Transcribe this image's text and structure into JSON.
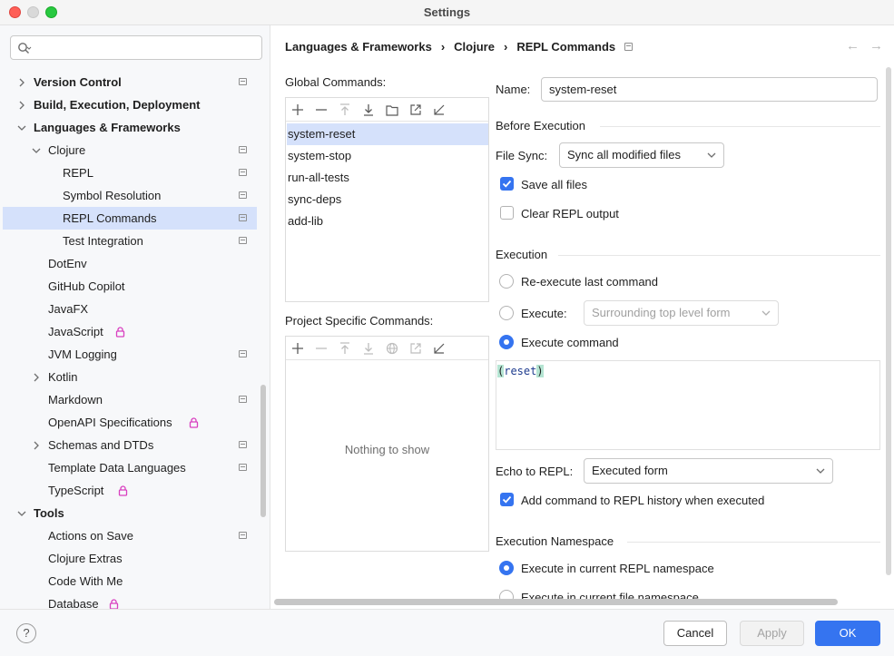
{
  "window": {
    "title": "Settings"
  },
  "search": {
    "placeholder": ""
  },
  "tree": {
    "items": [
      {
        "label": "Version Control"
      },
      {
        "label": "Build, Execution, Deployment"
      },
      {
        "label": "Languages & Frameworks"
      },
      {
        "label": "Clojure"
      },
      {
        "label": "REPL"
      },
      {
        "label": "Symbol Resolution"
      },
      {
        "label": "REPL Commands"
      },
      {
        "label": "Test Integration"
      },
      {
        "label": "DotEnv"
      },
      {
        "label": "GitHub Copilot"
      },
      {
        "label": "JavaFX"
      },
      {
        "label": "JavaScript"
      },
      {
        "label": "JVM Logging"
      },
      {
        "label": "Kotlin"
      },
      {
        "label": "Markdown"
      },
      {
        "label": "OpenAPI Specifications"
      },
      {
        "label": "Schemas and DTDs"
      },
      {
        "label": "Template Data Languages"
      },
      {
        "label": "TypeScript"
      },
      {
        "label": "Tools"
      },
      {
        "label": "Actions on Save"
      },
      {
        "label": "Clojure Extras"
      },
      {
        "label": "Code With Me"
      },
      {
        "label": "Database"
      }
    ]
  },
  "breadcrumb": {
    "part1": "Languages & Frameworks",
    "part2": "Clojure",
    "part3": "REPL Commands",
    "sep": "›"
  },
  "global_commands": {
    "label": "Global Commands:",
    "items": [
      "system-reset",
      "system-stop",
      "run-all-tests",
      "sync-deps",
      "add-lib"
    ]
  },
  "project_commands": {
    "label": "Project Specific Commands:",
    "empty_text": "Nothing to show"
  },
  "form": {
    "name_label": "Name:",
    "name_value": "system-reset",
    "before_execution": "Before Execution",
    "file_sync_label": "File Sync:",
    "file_sync_value": "Sync all modified files",
    "save_all_label": "Save all files",
    "save_all_checked": true,
    "clear_repl_label": "Clear REPL output",
    "clear_repl_checked": false,
    "execution": "Execution",
    "re_execute_label": "Re-execute last command",
    "execute_label": "Execute:",
    "execute_value": "Surrounding top level form",
    "execute_command_label": "Execute command",
    "code_open": "(",
    "code_text": "reset",
    "code_close": ")",
    "echo_label": "Echo to REPL:",
    "echo_value": "Executed form",
    "add_history_label": "Add command to REPL history when executed",
    "add_history_checked": true,
    "namespace_title": "Execution Namespace",
    "ns_current_repl": "Execute in current REPL namespace",
    "ns_current_file": "Execute in current file namespace"
  },
  "footer": {
    "help": "?",
    "cancel": "Cancel",
    "apply": "Apply",
    "ok": "OK"
  },
  "colors": {
    "accent": "#3574f0",
    "selection": "#d5e1fb",
    "close": "#fe5f57",
    "maximize": "#28c840",
    "lock": "#d940c0"
  }
}
